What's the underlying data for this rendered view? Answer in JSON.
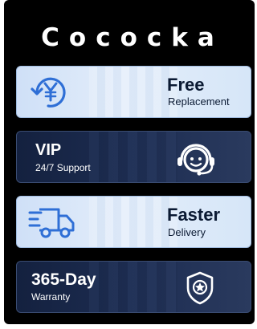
{
  "brand": {
    "name": "Cococka"
  },
  "cards": [
    {
      "title": "Free",
      "subtitle": "Replacement",
      "icon": "yen-refund-icon",
      "theme": "light"
    },
    {
      "title": "VIP",
      "subtitle": "24/7 Support",
      "icon": "headset-support-icon",
      "theme": "dark"
    },
    {
      "title": "Faster",
      "subtitle": "Delivery",
      "icon": "delivery-truck-icon",
      "theme": "light"
    },
    {
      "title": "365-Day",
      "subtitle": "Warranty",
      "icon": "warranty-badge-icon",
      "theme": "dark"
    }
  ],
  "colors": {
    "background": "#000000",
    "card_light": "#dbe8f9",
    "card_dark": "#1a2a4c",
    "icon_blue": "#2f6fd6",
    "text_dark": "#0b1a33",
    "text_light": "#ffffff"
  }
}
